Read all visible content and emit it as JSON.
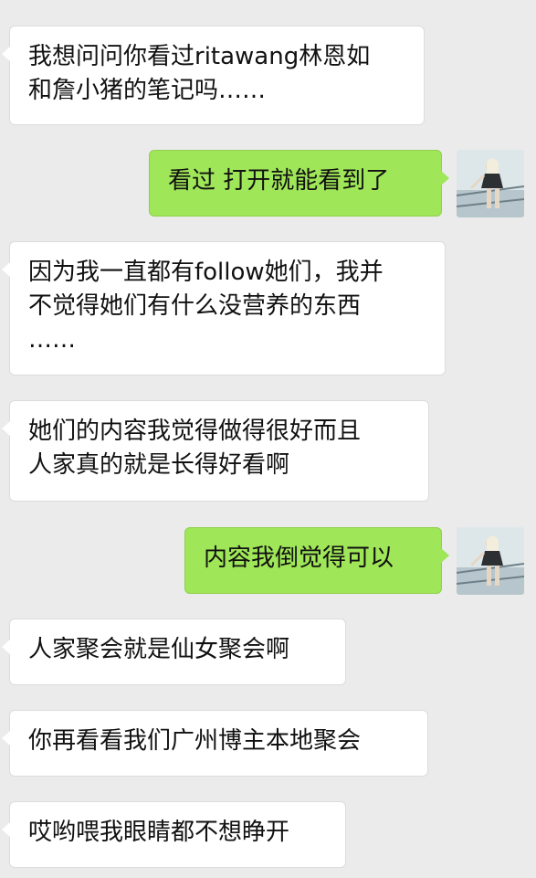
{
  "messages": [
    {
      "direction": "in",
      "text": "我想问问你看过ritawang林恩如\n和詹小猪的笔记吗……"
    },
    {
      "direction": "out",
      "text": "看过 打开就能看到了"
    },
    {
      "direction": "in",
      "text": "因为我一直都有follow她们，我并\n不觉得她们有什么没营养的东西\n……"
    },
    {
      "direction": "in",
      "text": "她们的内容我觉得做得很好而且\n人家真的就是长得好看啊"
    },
    {
      "direction": "out",
      "text": "内容我倒觉得可以"
    },
    {
      "direction": "in",
      "text": "人家聚会就是仙女聚会啊"
    },
    {
      "direction": "in",
      "text": "你再看看我们广州博主本地聚会"
    },
    {
      "direction": "in",
      "text": "哎哟喂我眼睛都不想睁开"
    }
  ],
  "colors": {
    "background": "#ebebeb",
    "incoming_bubble": "#ffffff",
    "outgoing_bubble": "#9fe658"
  }
}
